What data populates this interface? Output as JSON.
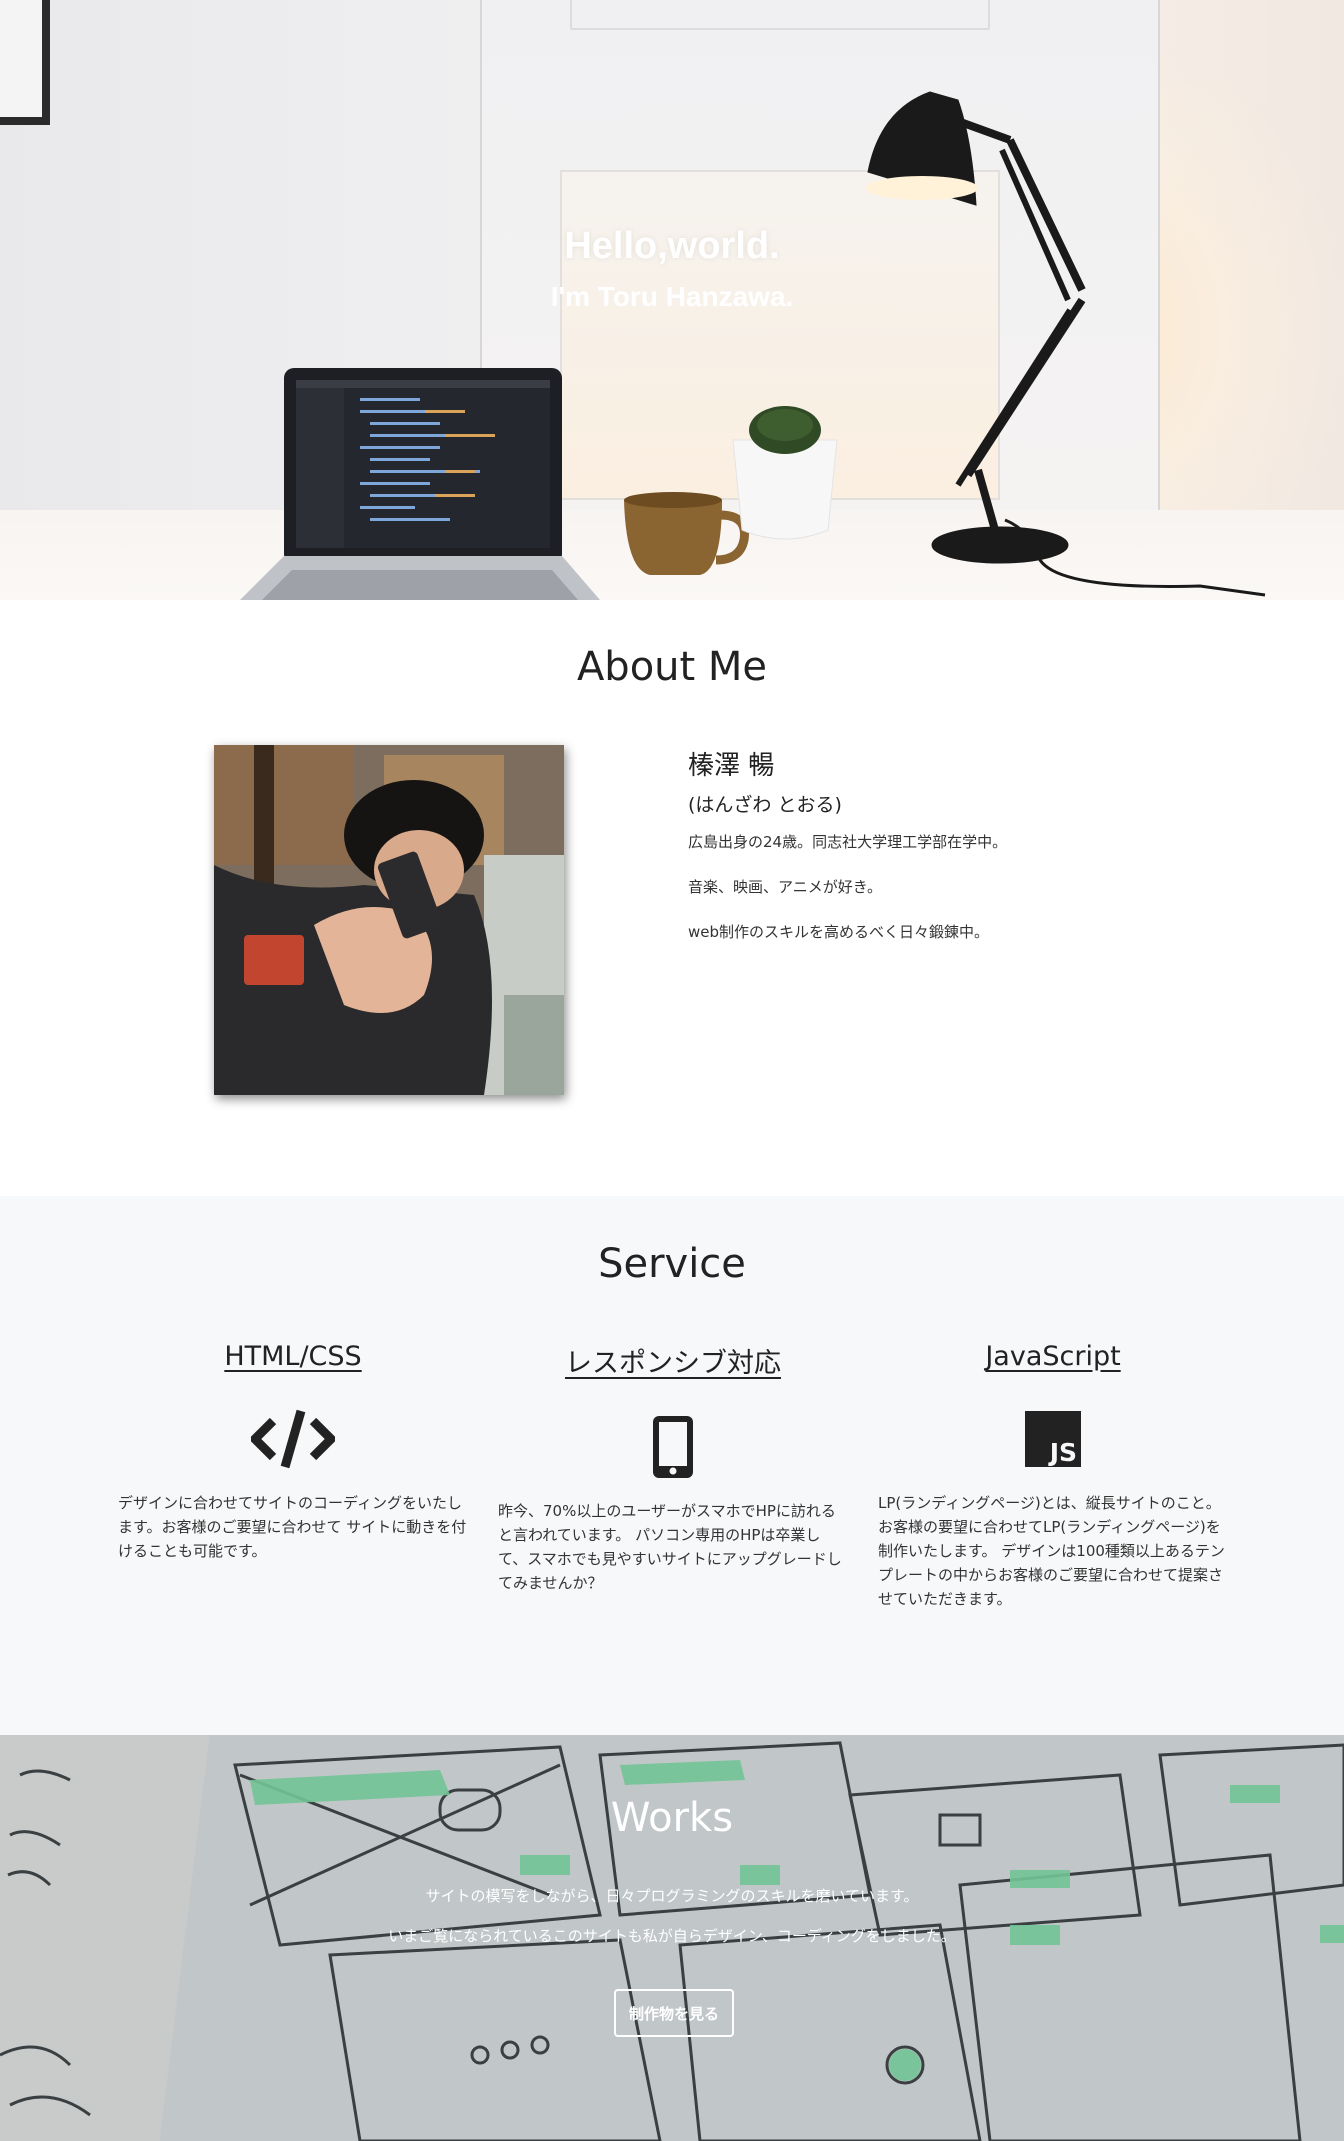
{
  "hero": {
    "title": "Hello,world.",
    "subtitle": "I'm Toru Hanzawa."
  },
  "about": {
    "heading": "About Me",
    "name": "榛澤 暢",
    "kana": "(はんざわ とおる)",
    "lines": [
      "広島出身の24歳。同志社大学理工学部在学中。",
      "音楽、映画、アニメが好き。",
      "web制作のスキルを高めるべく日々鍛錬中。"
    ]
  },
  "service": {
    "heading": "Service",
    "items": [
      {
        "title": "HTML/CSS",
        "icon": "code-icon",
        "text": "デザインに合わせてサイトのコーディングをいたします。お客様のご要望に合わせて サイトに動きを付けることも可能です。"
      },
      {
        "title": "レスポンシブ対応",
        "icon": "smartphone-icon",
        "text": "昨今、70%以上のユーザーがスマホでHPに訪れると言われています。 パソコン専用のHPは卒業して、スマホでも見やすいサイトにアップグレードしてみませんか？"
      },
      {
        "title": "JavaScript",
        "icon": "js-icon",
        "icon_text": "JS",
        "text": "LP(ランディングページ)とは、縦長サイトのこと。 お客様の要望に合わせてLP(ランディングページ)を制作いたします。 デザインは100種類以上あるテンプレートの中からお客様のご要望に合わせて提案させていただきます。"
      }
    ]
  },
  "works": {
    "heading": "Works",
    "text1": "サイトの模写をしながら、日々プログラミングのスキルを磨いています。",
    "text2": "いまご覧になられているこのサイトも私が自らデザイン、コーディングをしました。",
    "button_label": "制作物を見る"
  },
  "colors": {
    "text_dark": "#222222",
    "service_bg": "#f7f8f9",
    "icon_dark": "#222222",
    "works_highlight": "#7ee0a6"
  }
}
